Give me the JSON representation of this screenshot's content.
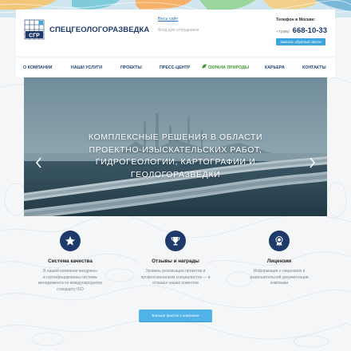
{
  "header": {
    "logo_text": "СПЕЦГЕОЛОГОРАЗВЕДКА",
    "link_all_site": "Весь сайт",
    "link_employees": "Вход для сотрудников",
    "phone_label": "Телефон в Москве:",
    "phone_code": "+7(495)",
    "phone_number": "668-10-33",
    "callback_label": "Заказать обратный звонок"
  },
  "nav": {
    "items": [
      {
        "label": "О КОМПАНИИ"
      },
      {
        "label": "НАШИ УСЛУГИ"
      },
      {
        "label": "ПРОЕКТЫ"
      },
      {
        "label": "ПРЕСС-ЦЕНТР"
      },
      {
        "label": "ОХРАНА ПРИРОДЫ",
        "icon": "leaf-icon",
        "color": "#3a9a2a"
      },
      {
        "label": "КАРЬЕРА"
      },
      {
        "label": "КОНТАКТЫ"
      }
    ]
  },
  "hero": {
    "lines": [
      "КОМПЛЕКСНЫЕ РЕШЕНИЯ В ОБЛАСТИ",
      "ПРОЕКТНО-ИЗЫСКАТЕЛЬСКИХ РАБОТ,",
      "ГИДРОГЕОЛОГИИ, КАРТОГРАФИИ И",
      "ГЕОЛОГОРАЗВЕДКИ"
    ],
    "prev_icon": "chevron-left-icon",
    "next_icon": "chevron-right-icon"
  },
  "features": [
    {
      "icon": "star-icon",
      "title": "Система качества",
      "desc": [
        "В нашей компании внедрены",
        "и сертифицированы системы",
        "менеджмента по международному",
        "стандарту ISO"
      ]
    },
    {
      "icon": "trophy-icon",
      "title": "Отзывы и награды",
      "desc": [
        "Уровень реализации проектов и",
        "профессионализм специалистов — в",
        "отзывах наших клиентов"
      ]
    },
    {
      "icon": "medal-icon",
      "title": "Лицензии",
      "desc": [
        "Информация о лицензиях и",
        "разрешительной документации",
        "компании"
      ]
    }
  ],
  "cta_label": "Больше фактов о компании",
  "colors": {
    "brand_navy": "#1d3a6b",
    "accent_blue": "#3da4df",
    "nature_green": "#3a9a2a"
  }
}
